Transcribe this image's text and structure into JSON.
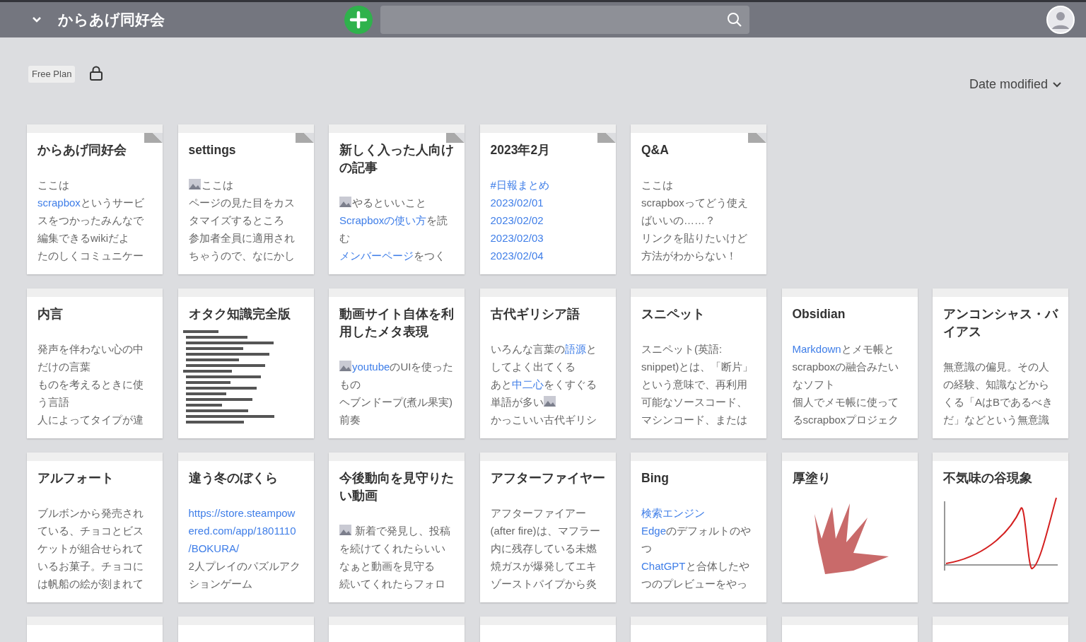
{
  "header": {
    "project_title": "からあげ同好会"
  },
  "plan_badge": "Free Plan",
  "private": true,
  "sort": {
    "label": "Date modified"
  },
  "cards": [
    {
      "title": "からあげ同好会",
      "pinned": true,
      "kind": "text",
      "lines": [
        [
          {
            "kind": "text",
            "text": "ここは"
          }
        ],
        [
          {
            "kind": "link",
            "text": "scrapbox"
          },
          {
            "kind": "text",
            "text": "というサービ"
          }
        ],
        [
          {
            "kind": "text",
            "text": "スをつかったみんなで"
          }
        ],
        [
          {
            "kind": "text",
            "text": "編集できるwikiだよ"
          }
        ],
        [
          {
            "kind": "text",
            "text": "たのしくコミュニケー"
          }
        ]
      ]
    },
    {
      "title": "settings",
      "pinned": true,
      "kind": "text",
      "lines": [
        [
          {
            "kind": "image"
          },
          {
            "kind": "text",
            "text": "ここは"
          }
        ],
        [
          {
            "kind": "text",
            "text": "ページの見た目をカス"
          }
        ],
        [
          {
            "kind": "text",
            "text": "タマイズするところ"
          }
        ],
        [
          {
            "kind": "text",
            "text": "参加者全員に適用され"
          }
        ],
        [
          {
            "kind": "text",
            "text": "ちゃうので、なにかし"
          }
        ]
      ]
    },
    {
      "title": "新しく入った人向けの記事",
      "pinned": true,
      "kind": "text",
      "lines": [
        [
          {
            "kind": "image"
          },
          {
            "kind": "text",
            "text": "やるといいこと"
          }
        ],
        [
          {
            "kind": "link",
            "text": "Scrapboxの使い方"
          },
          {
            "kind": "text",
            "text": "を読"
          }
        ],
        [
          {
            "kind": "text",
            "text": "む"
          }
        ],
        [
          {
            "kind": "link",
            "text": "メンバーページ"
          },
          {
            "kind": "text",
            "text": "をつく"
          }
        ]
      ]
    },
    {
      "title": "2023年2月",
      "pinned": true,
      "kind": "text",
      "lines": [
        [
          {
            "kind": "link",
            "text": "#日報まとめ"
          }
        ],
        [
          {
            "kind": "link",
            "text": "2023/02/01"
          }
        ],
        [
          {
            "kind": "link",
            "text": "2023/02/02"
          }
        ],
        [
          {
            "kind": "link",
            "text": "2023/02/03"
          }
        ],
        [
          {
            "kind": "link",
            "text": "2023/02/04"
          }
        ]
      ]
    },
    {
      "title": "Q&A",
      "pinned": true,
      "kind": "text",
      "lines": [
        [
          {
            "kind": "text",
            "text": "ここは"
          }
        ],
        [
          {
            "kind": "text",
            "text": "scrapboxってどう使え"
          }
        ],
        [
          {
            "kind": "text",
            "text": "ばいいの……？"
          }
        ],
        [
          {
            "kind": "text",
            "text": "リンクを貼りたいけど"
          }
        ],
        [
          {
            "kind": "text",
            "text": "方法がわからない！"
          }
        ]
      ]
    },
    {
      "title": "内言",
      "pinned": false,
      "kind": "text",
      "lines": [
        [
          {
            "kind": "text",
            "text": "発声を伴わない心の中"
          }
        ],
        [
          {
            "kind": "text",
            "text": "だけの言葉"
          }
        ],
        [
          {
            "kind": "text",
            "text": "ものを考えるときに使"
          }
        ],
        [
          {
            "kind": "text",
            "text": "う言語"
          }
        ],
        [
          {
            "kind": "text",
            "text": "人によってタイプが違"
          }
        ]
      ]
    },
    {
      "title": "オタク知識完全版",
      "pinned": false,
      "kind": "list_image"
    },
    {
      "title": "動画サイト自体を利用したメタ表現",
      "pinned": false,
      "kind": "text",
      "lines": [
        [
          {
            "kind": "image"
          },
          {
            "kind": "link",
            "text": "youtube"
          },
          {
            "kind": "text",
            "text": "のUIを使った"
          }
        ],
        [
          {
            "kind": "text",
            "text": "もの"
          }
        ],
        [
          {
            "kind": "text",
            "text": "ヘブンドープ(煮ル果実)"
          }
        ],
        [
          {
            "kind": "text",
            "text": "前奏"
          }
        ]
      ]
    },
    {
      "title": "古代ギリシア語",
      "pinned": false,
      "kind": "text",
      "lines": [
        [
          {
            "kind": "text",
            "text": "いろんな言葉の"
          },
          {
            "kind": "link",
            "text": "語源"
          },
          {
            "kind": "text",
            "text": "と"
          }
        ],
        [
          {
            "kind": "text",
            "text": "してよく出てくる"
          }
        ],
        [
          {
            "kind": "text",
            "text": "あと"
          },
          {
            "kind": "link",
            "text": "中二心"
          },
          {
            "kind": "text",
            "text": "をくすぐる"
          }
        ],
        [
          {
            "kind": "text",
            "text": "単語が多い"
          },
          {
            "kind": "image"
          }
        ],
        [
          {
            "kind": "text",
            "text": "かっこいい古代ギリシ"
          }
        ]
      ]
    },
    {
      "title": "スニペット",
      "pinned": false,
      "kind": "text",
      "lines": [
        [
          {
            "kind": "text",
            "text": "スニペット(英語:"
          }
        ],
        [
          {
            "kind": "text",
            "text": "snippet)とは、「断片」"
          }
        ],
        [
          {
            "kind": "text",
            "text": "という意味で、再利用"
          }
        ],
        [
          {
            "kind": "text",
            "text": "可能なソースコード、"
          }
        ],
        [
          {
            "kind": "text",
            "text": "マシンコード、または"
          }
        ]
      ]
    },
    {
      "title": "Obsidian",
      "pinned": false,
      "kind": "text",
      "lines": [
        [
          {
            "kind": "link",
            "text": "Markdown"
          },
          {
            "kind": "text",
            "text": "とメモ帳と"
          }
        ],
        [
          {
            "kind": "text",
            "text": "scrapboxの融合みたい"
          }
        ],
        [
          {
            "kind": "text",
            "text": "なソフト"
          }
        ],
        [
          {
            "kind": "text",
            "text": "個人でメモ帳に使って"
          }
        ],
        [
          {
            "kind": "text",
            "text": "るscrapboxプロジェク"
          }
        ]
      ]
    },
    {
      "title": "アンコンシャス・バイアス",
      "pinned": false,
      "kind": "text",
      "lines": [
        [
          {
            "kind": "text",
            "text": "無意識の偏見。その人"
          }
        ],
        [
          {
            "kind": "text",
            "text": "の経験、知識などから"
          }
        ],
        [
          {
            "kind": "text",
            "text": "くる「AはBであるべき"
          }
        ],
        [
          {
            "kind": "text",
            "text": "だ」などという無意識"
          }
        ]
      ]
    },
    {
      "title": "アルフォート",
      "pinned": false,
      "kind": "text",
      "lines": [
        [
          {
            "kind": "text",
            "text": "ブルボンから発売され"
          }
        ],
        [
          {
            "kind": "text",
            "text": "ている、チョコとビス"
          }
        ],
        [
          {
            "kind": "text",
            "text": "ケットが組合せられて"
          }
        ],
        [
          {
            "kind": "text",
            "text": "いるお菓子。チョコに"
          }
        ],
        [
          {
            "kind": "text",
            "text": "は帆船の絵が刻まれて"
          }
        ]
      ]
    },
    {
      "title": "違う冬のぼくら",
      "pinned": false,
      "kind": "text",
      "lines": [
        [
          {
            "kind": "link",
            "text": "https://store.steampow"
          }
        ],
        [
          {
            "kind": "link",
            "text": "ered.com/app/1801110"
          }
        ],
        [
          {
            "kind": "link",
            "text": "/BOKURA/"
          }
        ],
        [
          {
            "kind": "text",
            "text": "2人プレイのパズルアク"
          }
        ],
        [
          {
            "kind": "text",
            "text": "ションゲーム"
          }
        ]
      ]
    },
    {
      "title": "今後動向を見守りたい動画",
      "pinned": false,
      "kind": "text",
      "lines": [
        [
          {
            "kind": "image"
          },
          {
            "kind": "text",
            "text": " 新着で発見し、投稿"
          }
        ],
        [
          {
            "kind": "text",
            "text": "を続けてくれたらいい"
          }
        ],
        [
          {
            "kind": "text",
            "text": "なぁと動画を見守る"
          }
        ],
        [
          {
            "kind": "text",
            "text": "続いてくれたらフォロ"
          }
        ]
      ]
    },
    {
      "title": "アフターファイヤー",
      "pinned": false,
      "kind": "text",
      "lines": [
        [
          {
            "kind": "text",
            "text": "アフターファイアー"
          }
        ],
        [
          {
            "kind": "text",
            "text": "(after fire)は、マフラー"
          }
        ],
        [
          {
            "kind": "text",
            "text": "内に残存している未燃"
          }
        ],
        [
          {
            "kind": "text",
            "text": "焼ガスが爆発してエキ"
          }
        ],
        [
          {
            "kind": "text",
            "text": "ゾーストパイプから炎"
          }
        ]
      ]
    },
    {
      "title": "Bing",
      "pinned": false,
      "kind": "text",
      "lines": [
        [
          {
            "kind": "link",
            "text": "検索エンジン"
          }
        ],
        [
          {
            "kind": "link",
            "text": "Edge"
          },
          {
            "kind": "text",
            "text": "のデフォルトのや"
          }
        ],
        [
          {
            "kind": "text",
            "text": "つ"
          }
        ],
        [
          {
            "kind": "link",
            "text": "ChatGPT"
          },
          {
            "kind": "text",
            "text": "と合体したや"
          }
        ],
        [
          {
            "kind": "text",
            "text": "つのプレビューをやっ"
          }
        ]
      ]
    },
    {
      "title": "厚塗り",
      "pinned": false,
      "kind": "photo"
    },
    {
      "title": "不気味の谷現象",
      "pinned": false,
      "kind": "graph_image"
    },
    {
      "pinned": false,
      "kind": "text"
    },
    {
      "pinned": false,
      "kind": "text"
    },
    {
      "pinned": false,
      "kind": "text"
    },
    {
      "pinned": false,
      "kind": "text"
    },
    {
      "pinned": false,
      "kind": "text"
    },
    {
      "pinned": false,
      "kind": "text"
    },
    {
      "pinned": false,
      "kind": "text"
    }
  ]
}
